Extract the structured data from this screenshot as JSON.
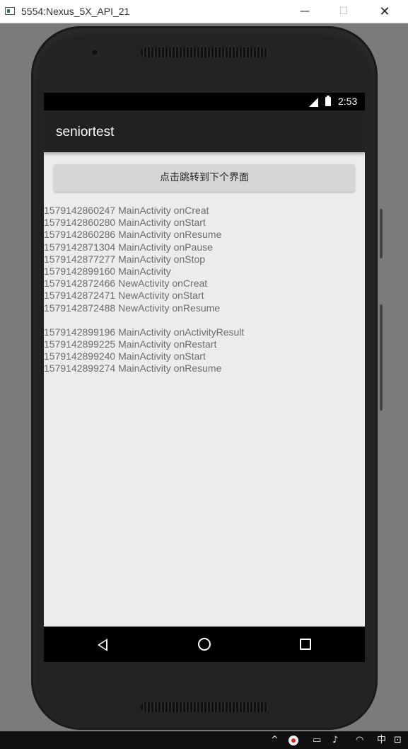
{
  "window": {
    "title": "5554:Nexus_5X_API_21",
    "minimize_glyph": "—",
    "maximize_glyph": "☐",
    "close_glyph": "✕"
  },
  "status_bar": {
    "time": "2:53",
    "icons": [
      "signal-icon",
      "battery-icon"
    ]
  },
  "app_bar": {
    "title": "seniortest"
  },
  "main": {
    "jump_button_label": "点击跳转到下个界面",
    "log_lines": [
      "1579142860247 MainActivity onCreat",
      "1579142860280 MainActivity onStart",
      "1579142860286 MainActivity onResume",
      "1579142871304 MainActivity onPause",
      "1579142877277 MainActivity onStop",
      "1579142899160 MainActivity",
      "1579142872466 NewActivity onCreat",
      "1579142872471 NewActivity onStart",
      "1579142872488 NewActivity onResume",
      "",
      "1579142899196 MainActivity onActivityResult",
      "1579142899225 MainActivity onRestart",
      "1579142899240 MainActivity onStart",
      "1579142899274 MainActivity onResume"
    ]
  },
  "nav_bar": {
    "icons": [
      "back-icon",
      "home-icon",
      "recents-icon"
    ]
  },
  "taskbar": {
    "chevron": "^",
    "volume_glyph": "♪",
    "wifi_glyph": "◠",
    "ime_label": "中",
    "extra_glyph": "⊡"
  }
}
